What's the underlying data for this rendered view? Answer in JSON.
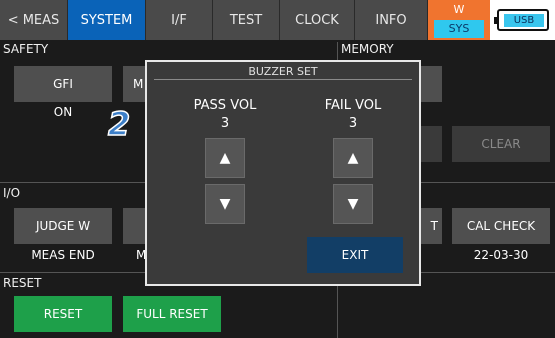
{
  "tabs": [
    "< MEAS",
    "SYSTEM",
    "I/F",
    "TEST",
    "CLOCK",
    "INFO"
  ],
  "status": {
    "w": "W",
    "sys": "SYS",
    "usb": "USB"
  },
  "safety": {
    "title": "SAFETY",
    "gfi_label": "GFI",
    "gfi_value": "ON",
    "partial_btn": "M"
  },
  "memory": {
    "title": "MEMORY",
    "clear_label": "CLEAR"
  },
  "io": {
    "title": "I/O",
    "judge_label": "JUDGE W",
    "judge_value": "MEAS END",
    "partial_value": "M",
    "partial_btn_right": "T",
    "cal_check_label": "CAL CHECK",
    "cal_check_value": "22-03-30"
  },
  "reset": {
    "title": "RESET",
    "reset_label": "RESET",
    "full_reset_label": "FULL RESET"
  },
  "dialog": {
    "title": "BUZZER SET",
    "pass_label": "PASS VOL",
    "pass_value": "3",
    "fail_label": "FAIL VOL",
    "fail_value": "3",
    "up_glyph": "▲",
    "down_glyph": "▼",
    "exit_label": "EXIT"
  },
  "step_number": "2"
}
